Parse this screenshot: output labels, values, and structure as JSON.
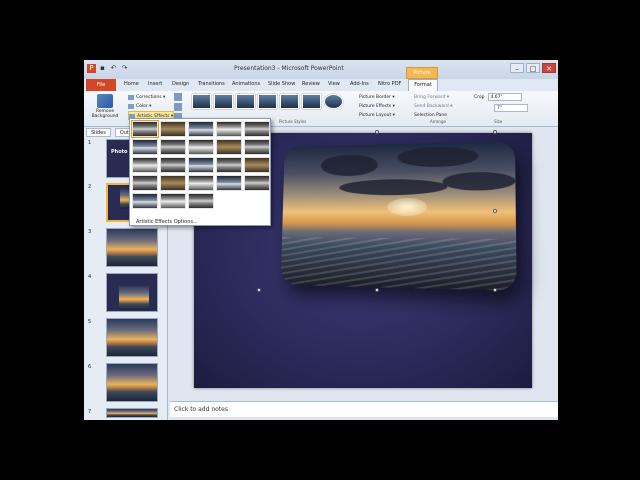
{
  "window": {
    "title": "Presentation3 - Microsoft PowerPoint",
    "context_tab": "Picture Tools",
    "buttons": [
      "–",
      "□",
      "✕"
    ]
  },
  "tabs": [
    "File",
    "Home",
    "Insert",
    "Design",
    "Transitions",
    "Animations",
    "Slide Show",
    "Review",
    "View",
    "Add-Ins",
    "Nitro PDF",
    "Format"
  ],
  "ribbon": {
    "remove_background": "Remove Background",
    "adjust": [
      "Corrections ▾",
      "Color ▾",
      "Artistic Effects ▾"
    ],
    "picture_styles_label": "Picture Styles",
    "border_options": [
      "Picture Border ▾",
      "Picture Effects ▾",
      "Picture Layout ▾"
    ],
    "arrange_options": [
      "Bring Forward ▾",
      "Send Backward ▾",
      "Selection Pane"
    ],
    "arrange_label": "Arrange",
    "size": {
      "height": "4.67\"",
      "width": "7\"",
      "crop": "Crop",
      "label": "Size"
    }
  },
  "left_panel": {
    "tabs": [
      "Slides",
      "Outline"
    ],
    "first_slide_title": "Photo Al",
    "slide_numbers": [
      "1",
      "2",
      "3",
      "4",
      "5",
      "6",
      "7"
    ]
  },
  "dropdown": {
    "option": "Artistic Effects Options..."
  },
  "notes": {
    "placeholder": "Click to add notes"
  }
}
